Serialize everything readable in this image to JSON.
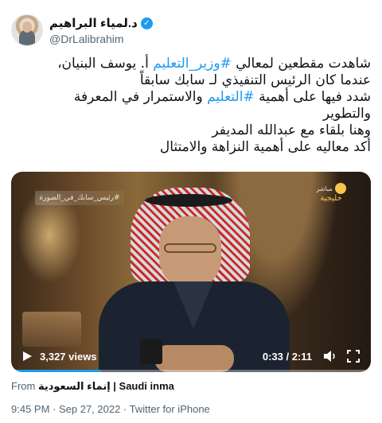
{
  "author": {
    "display_name": "د.لمياء البراهيم",
    "handle": "@DrLalibrahim",
    "verified": true
  },
  "tweet": {
    "lines": [
      [
        {
          "text": "شاهدت مقطعين لمعالي "
        },
        {
          "text": "#وزير_التعليم",
          "hashtag": true
        },
        {
          "text": " أ. يوسف البنيان،"
        }
      ],
      [
        {
          "text": "عندما كان الرئيس التنفيذي لـ سابك سابقاً"
        }
      ],
      [
        {
          "text": "شدد فيها على أهمية "
        },
        {
          "text": "#التعليم",
          "hashtag": true
        },
        {
          "text": " والاستمرار في المعرفة"
        }
      ],
      [
        {
          "text": "والتطوير"
        }
      ],
      [
        {
          "text": "وهنا بلقاء مع عبدالله المديفر"
        }
      ],
      [
        {
          "text": "أكد معاليه على أهمية النزاهة والامتثال"
        }
      ]
    ]
  },
  "video": {
    "overlay_badge": "#رئيس_سابك_في_الصورة",
    "channel_live": "مباشر",
    "channel_name": "خليجية",
    "views": "3,327 views",
    "time": "0:33 / 2:11",
    "progress": 0.25
  },
  "source": {
    "from_label": "From",
    "name": "إنماء السعودية | Saudi inma"
  },
  "meta": {
    "text": "9:45 PM · Sep 27, 2022 · Twitter for iPhone"
  },
  "colors": {
    "link": "#1d9bf0",
    "secondary_text": "#536471"
  }
}
